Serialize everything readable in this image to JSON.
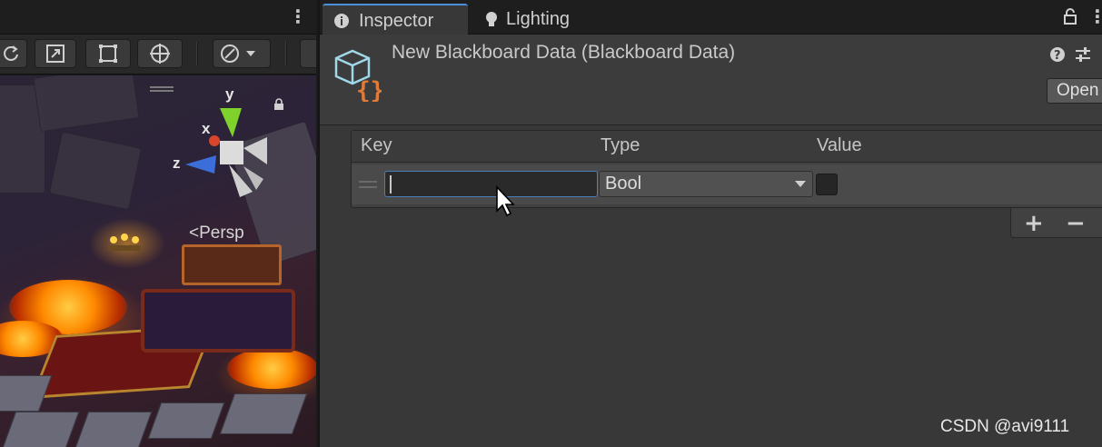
{
  "scene": {
    "persp_label": "Persp",
    "gizmo": {
      "x_label": "x",
      "y_label": "y",
      "z_label": "z"
    },
    "toolbar_icons": [
      "rotate-icon",
      "scale-icon",
      "rect-tool-icon",
      "transform-tool-icon",
      "gizmo-dropdown-icon"
    ]
  },
  "inspector": {
    "tabs": [
      {
        "label": "Inspector",
        "icon": "info-icon",
        "active": true
      },
      {
        "label": "Lighting",
        "icon": "bulb-icon",
        "active": false
      }
    ],
    "asset_title": "New Blackboard Data (Blackboard Data)",
    "open_label": "Open",
    "list": {
      "columns": [
        "Key",
        "Type",
        "Value"
      ],
      "rows": [
        {
          "key": "",
          "type": "Bool",
          "value": false
        }
      ],
      "add_label": "+",
      "remove_label": "−"
    }
  },
  "colors": {
    "accent": "#4a90d9",
    "panel": "#383838",
    "asset_icon_brace": "#e07a3a",
    "gizmo_y": "#7fd12b",
    "gizmo_z": "#3b6ed8",
    "gizmo_x": "#d8452d"
  },
  "watermark": "CSDN @avi9111"
}
